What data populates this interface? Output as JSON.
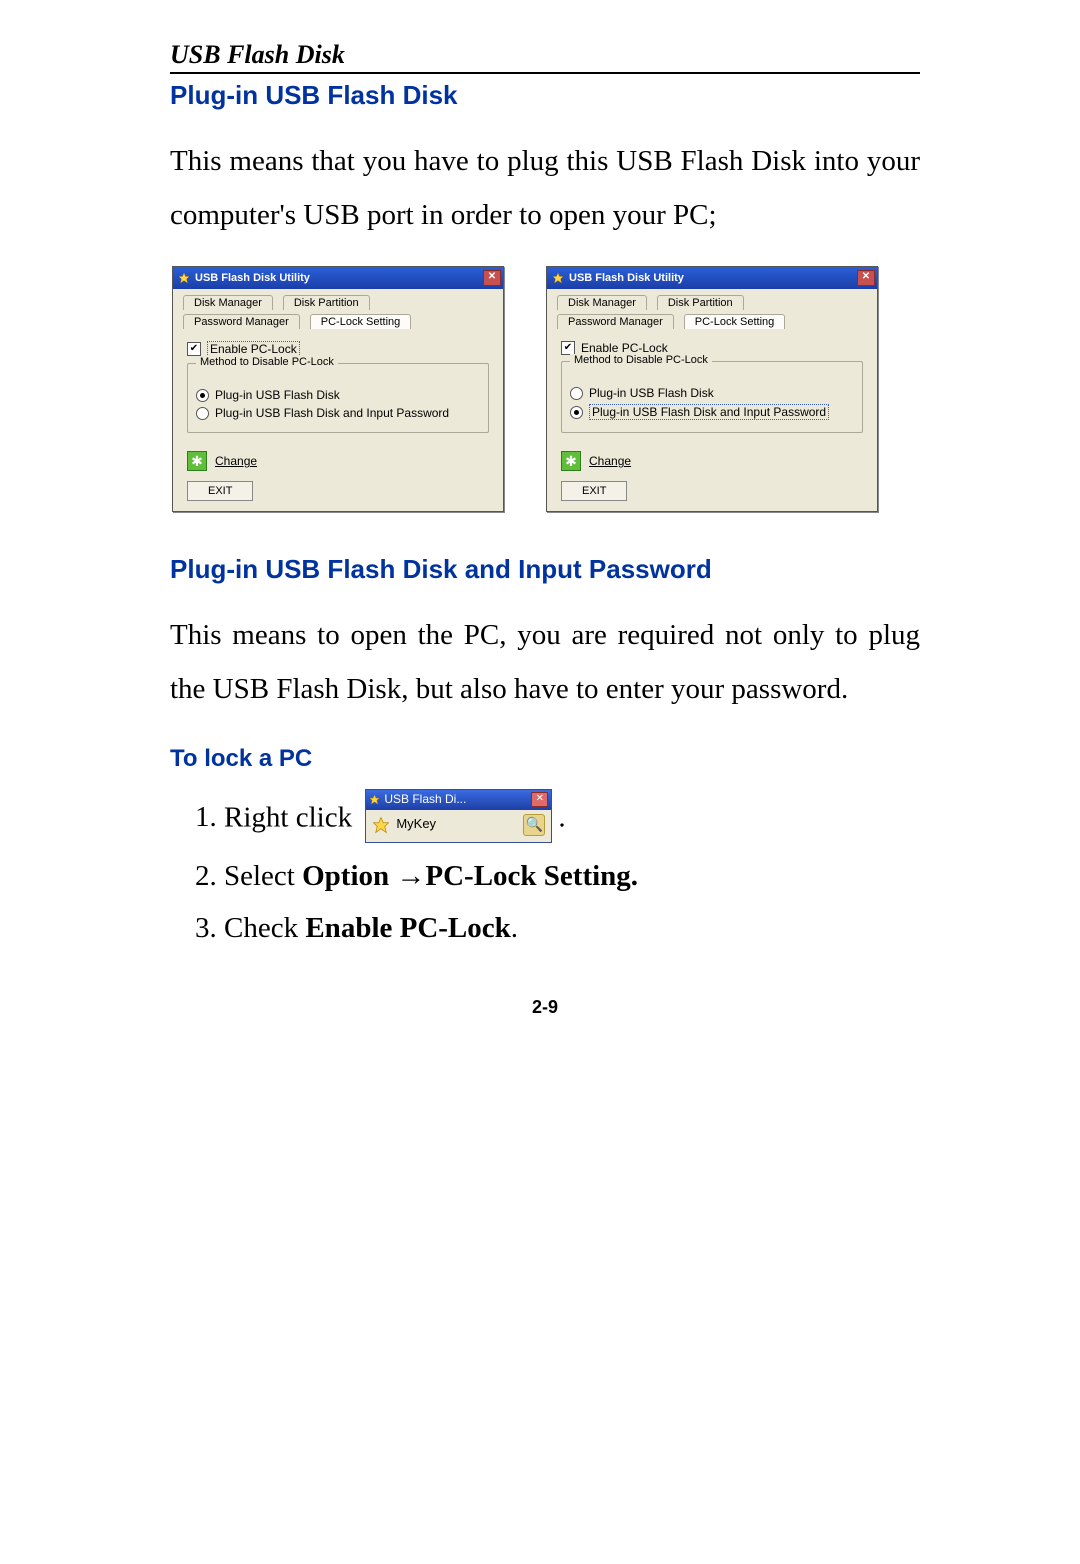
{
  "doc_title": "USB Flash Disk",
  "section1": {
    "heading": "Plug-in USB Flash Disk",
    "body": "This means that you have to plug this USB Flash Disk into your computer's USB port in order to open your PC;"
  },
  "dialogA": {
    "title": "USB Flash Disk Utility",
    "tabs": [
      "Disk Manager",
      "Disk Partition",
      "Password Manager",
      "PC-Lock Setting"
    ],
    "enable_label": "Enable PC-Lock",
    "group_legend": "Method to Disable PC-Lock",
    "radio1": "Plug-in USB Flash Disk",
    "radio2": "Plug-in USB Flash Disk and Input Password",
    "change_label": "Change",
    "exit_label": "EXIT",
    "selected_radio": 1
  },
  "dialogB": {
    "title": "USB Flash Disk Utility",
    "tabs": [
      "Disk Manager",
      "Disk Partition",
      "Password Manager",
      "PC-Lock Setting"
    ],
    "enable_label": "Enable PC-Lock",
    "group_legend": "Method to Disable PC-Lock",
    "radio1": "Plug-in USB Flash Disk",
    "radio2": "Plug-in USB Flash Disk and Input Password",
    "change_label": "Change",
    "exit_label": "EXIT",
    "selected_radio": 2
  },
  "section2": {
    "heading": "Plug-in USB Flash Disk and Input Password",
    "body": "This means to open the PC, you are required not only to plug the USB Flash Disk, but also have to enter your password."
  },
  "section3": {
    "heading": "To lock a PC",
    "step1_pre": "Right click",
    "step1_post": ".",
    "step2_a": "Select ",
    "step2_b": "Option ",
    "step2_arrow": "→",
    "step2_c": "PC-Lock Setting.",
    "step3_a": "Check ",
    "step3_b": "Enable PC-Lock",
    "step3_c": "."
  },
  "tray": {
    "title": "USB Flash Di...",
    "item": "MyKey"
  },
  "page_number": "2-9"
}
